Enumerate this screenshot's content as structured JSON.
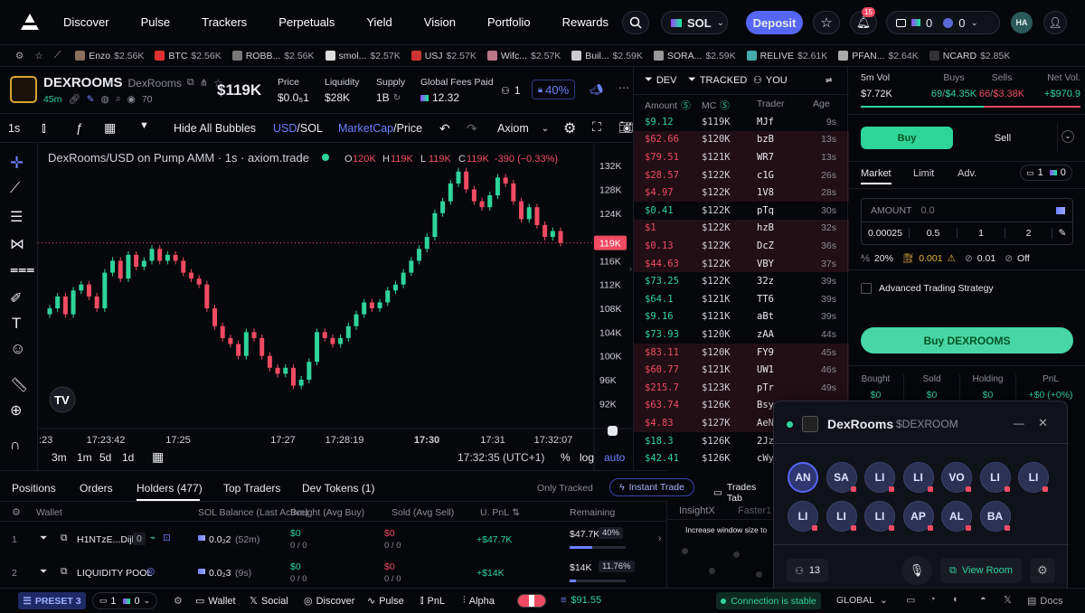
{
  "nav": {
    "links": [
      "Discover",
      "Pulse",
      "Trackers",
      "Perpetuals",
      "Yield",
      "Vision",
      "Portfolio",
      "Rewards"
    ],
    "chain": "SOL",
    "deposit": "Deposit",
    "notif_count": "15",
    "wallet_sol": "0",
    "wallet_usdc": "0",
    "avatar": "HA",
    "accent": "#5566f6"
  },
  "ticker": [
    {
      "name": "Enzo",
      "price": "$2.56K",
      "color": "#8a6e5a"
    },
    {
      "name": "BTC",
      "price": "$2.56K",
      "color": "#d33"
    },
    {
      "name": "ROBB...",
      "price": "$2.56K",
      "color": "#777"
    },
    {
      "name": "smol...",
      "price": "$2.57K",
      "color": "#ddd"
    },
    {
      "name": "USJ",
      "price": "$2.57K",
      "color": "#c33"
    },
    {
      "name": "Wifc...",
      "price": "$2.57K",
      "color": "#b78"
    },
    {
      "name": "Buil...",
      "price": "$2.59K",
      "color": "#ccc"
    },
    {
      "name": "SORA...",
      "price": "$2.59K",
      "color": "#999"
    },
    {
      "name": "RELIVE",
      "price": "$2.61K",
      "color": "#4aa"
    },
    {
      "name": "PFAN...",
      "price": "$2.64K",
      "color": "#aaa"
    },
    {
      "name": "NCARD",
      "price": "$2.85K",
      "color": "#333"
    }
  ],
  "token": {
    "ticker": "DEXROOMS",
    "name": "DexRooms",
    "age": "45m",
    "views": "70",
    "mcap": "$119K",
    "price_label": "Price",
    "price": "$0.0₅1",
    "liq_label": "Liquidity",
    "liq": "$28K",
    "supply_label": "Supply",
    "supply": "1B",
    "fees_label": "Global Fees Paid",
    "fees": "12.32",
    "holders_icon_count": "1",
    "pct": "40%"
  },
  "chart_toolbar": {
    "interval": "1s",
    "hide": "Hide All Bubbles",
    "usd": "USD",
    "sol": "SOL",
    "mc": "MarketCap",
    "price": "Price",
    "source": "Axiom"
  },
  "chart_data": {
    "type": "candlestick",
    "title": "DexRooms/USD on Pump AMM · 1s · axiom.trade",
    "ohlc": {
      "o": "120K",
      "h": "119K",
      "l": "119K",
      "c": "119K",
      "chg": "-390 (−0.33%)"
    },
    "y_ticks": [
      "132K",
      "128K",
      "124K",
      "120K",
      "116K",
      "112K",
      "108K",
      "104K",
      "100K",
      "96K",
      "92K"
    ],
    "y_values": [
      132,
      128,
      124,
      120,
      116,
      112,
      108,
      104,
      100,
      96,
      92
    ],
    "current": "119K",
    "current_value": 119,
    "x_ticks": [
      ":23",
      "17:23:42",
      "17:25",
      "17:27",
      "17:28:19",
      "17:30",
      "17:31",
      "17:32:07"
    ],
    "x_bold": "17:30",
    "timestamp": "17:32:35 (UTC+1)",
    "ranges": [
      "3m",
      "1m",
      "5d",
      "1d"
    ],
    "scale": [
      "%",
      "log",
      "auto"
    ],
    "close_values": [
      108,
      110,
      107,
      111,
      112,
      110,
      108,
      114,
      116,
      113,
      117,
      115,
      116,
      118,
      116,
      117,
      116,
      114,
      113,
      112,
      108,
      105,
      103,
      102,
      100,
      104,
      103,
      100,
      98,
      97,
      98,
      95,
      96,
      99,
      104,
      103,
      102,
      103,
      105,
      107,
      109,
      108,
      109,
      111,
      112,
      114,
      116,
      118,
      120,
      124,
      126,
      129,
      131,
      128,
      126,
      125,
      127,
      130,
      129,
      126,
      123,
      125,
      122,
      120,
      121,
      119
    ]
  },
  "trades_head": {
    "dev": "DEV",
    "tracked": "TRACKED",
    "you": "YOU",
    "amount": "Amount",
    "mc": "MC",
    "trader": "Trader",
    "age": "Age"
  },
  "trades": [
    {
      "amt": "$9.12",
      "side": "buy",
      "mc": "$119K",
      "trader": "MJf",
      "age": "9s"
    },
    {
      "amt": "$62.66",
      "side": "sell",
      "mc": "$120K",
      "trader": "bzB",
      "age": "13s"
    },
    {
      "amt": "$79.51",
      "side": "sell",
      "mc": "$121K",
      "trader": "WR7",
      "age": "13s"
    },
    {
      "amt": "$28.57",
      "side": "sell",
      "mc": "$122K",
      "trader": "c1G",
      "age": "26s"
    },
    {
      "amt": "$4.97",
      "side": "sell",
      "mc": "$122K",
      "trader": "1V8",
      "age": "28s"
    },
    {
      "amt": "$0.41",
      "side": "buy",
      "mc": "$122K",
      "trader": "pTq",
      "age": "30s"
    },
    {
      "amt": "$1",
      "side": "sell",
      "mc": "$122K",
      "trader": "hzB",
      "age": "32s"
    },
    {
      "amt": "$0.13",
      "side": "sell",
      "mc": "$122K",
      "trader": "DcZ",
      "age": "36s"
    },
    {
      "amt": "$44.63",
      "side": "sell",
      "mc": "$122K",
      "trader": "VBY",
      "age": "37s"
    },
    {
      "amt": "$73.25",
      "side": "buy",
      "mc": "$122K",
      "trader": "32z",
      "age": "39s"
    },
    {
      "amt": "$64.1",
      "side": "buy",
      "mc": "$121K",
      "trader": "TT6",
      "age": "39s"
    },
    {
      "amt": "$9.16",
      "side": "buy",
      "mc": "$121K",
      "trader": "aBt",
      "age": "39s"
    },
    {
      "amt": "$73.93",
      "side": "buy",
      "mc": "$120K",
      "trader": "zAA",
      "age": "44s"
    },
    {
      "amt": "$83.11",
      "side": "sell",
      "mc": "$120K",
      "trader": "FY9",
      "age": "45s"
    },
    {
      "amt": "$60.77",
      "side": "sell",
      "mc": "$121K",
      "trader": "UW1",
      "age": "46s"
    },
    {
      "amt": "$215.7",
      "side": "sell",
      "mc": "$123K",
      "trader": "pTr",
      "age": "49s"
    },
    {
      "amt": "$63.74",
      "side": "sell",
      "mc": "$126K",
      "trader": "Bsy",
      "age": ""
    },
    {
      "amt": "$4.83",
      "side": "sell",
      "mc": "$127K",
      "trader": "AeN",
      "age": ""
    },
    {
      "amt": "$18.3",
      "side": "buy",
      "mc": "$126K",
      "trader": "2Jz",
      "age": ""
    },
    {
      "amt": "$42.41",
      "side": "buy",
      "mc": "$126K",
      "trader": "cWy",
      "age": ""
    }
  ],
  "side": {
    "vol_label": "5m Vol",
    "vol": "$7.72K",
    "buys_label": "Buys",
    "buys_n": "69",
    "buys_v": "$4.35K",
    "sells_label": "Sells",
    "sells_n": "66",
    "sells_v": "$3.38K",
    "net_label": "Net Vol.",
    "net": "+$970.9",
    "buy": "Buy",
    "sell": "Sell",
    "tabs": [
      "Market",
      "Limit",
      "Adv."
    ],
    "preset_a": "1",
    "preset_b": "0",
    "amount_label": "AMOUNT",
    "amount_val": "0.0",
    "quick": [
      "0.00025",
      "0.5",
      "1",
      "2"
    ],
    "slip": "20%",
    "prio": "0.001",
    "bribe": "0.01",
    "mev": "Off",
    "adv": "Advanced Trading Strategy",
    "buy_btn": "Buy DEXROOMS",
    "stats": [
      {
        "l": "Bought",
        "v": "$0"
      },
      {
        "l": "Sold",
        "v": "$0"
      },
      {
        "l": "Holding",
        "v": "$0"
      },
      {
        "l": "PnL",
        "v": "+$0 (+0%)"
      }
    ]
  },
  "bottom": {
    "tabs": [
      "Positions",
      "Orders",
      "Holders (477)",
      "Top Traders",
      "Dev Tokens (1)"
    ],
    "only_tracked": "Only Tracked",
    "instant": "Instant Trade",
    "trades_tab": "Trades Tab",
    "cols": [
      "Wallet",
      "SOL Balance (Last Active)",
      "Bought (Avg Buy)",
      "Sold (Avg Sell)",
      "U. PnL",
      "Remaining"
    ],
    "rows": [
      {
        "n": "1",
        "wallet": "H1NTzE...Dijb",
        "badge": "0",
        "bal": "0.0₂2",
        "bal_t": "(52m)",
        "bought": "$0",
        "bought2": "0 / 0",
        "sold": "$0",
        "sold2": "0 / 0",
        "pnl": "+$47.7K",
        "rem": "$47.7K",
        "pct": "40%",
        "fill": 0.4
      },
      {
        "n": "2",
        "wallet": "LIQUIDITY POOL",
        "badge": "",
        "bal": "0.0₂3",
        "bal_t": "(9s)",
        "bought": "$0",
        "bought2": "0 / 0",
        "sold": "$0",
        "sold2": "0 / 0",
        "pnl": "+$14K",
        "rem": "$14K",
        "pct": "11.76%",
        "fill": 0.1176
      }
    ],
    "insight": "InsightX",
    "faster": "Faster1",
    "note": "Increase window size to"
  },
  "room": {
    "name": "DexRooms",
    "ticker": "$DEXROOM",
    "members": [
      "AN",
      "SA",
      "LI",
      "LI",
      "VO",
      "LI",
      "LI",
      "LI",
      "LI",
      "LI",
      "AP",
      "AL",
      "BA"
    ],
    "count": "13",
    "view": "View Room"
  },
  "footer": {
    "preset": "PRESET 3",
    "p1": "1",
    "p2": "0",
    "items": [
      "Wallet",
      "Social",
      "Discover",
      "Pulse",
      "PnL",
      "Alpha"
    ],
    "balance": "$91.55",
    "conn": "Connection is stable",
    "region": "GLOBAL",
    "docs": "Docs"
  }
}
